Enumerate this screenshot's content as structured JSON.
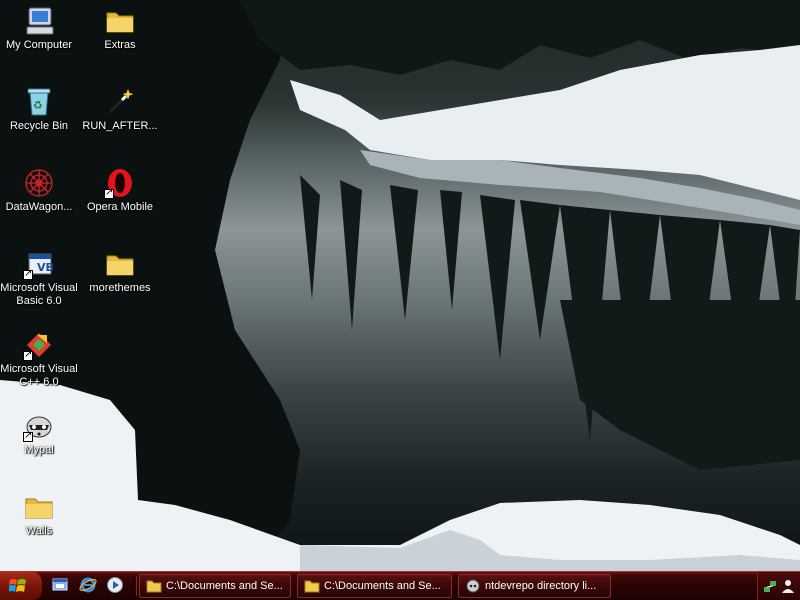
{
  "desktop": {
    "icons": [
      {
        "label": "My Computer",
        "icon": "my-computer-icon"
      },
      {
        "label": "Extras",
        "icon": "folder-icon"
      },
      {
        "label": "Recycle Bin",
        "icon": "recycle-bin-icon"
      },
      {
        "label": "RUN_AFTER...",
        "icon": "magic-wand-icon"
      },
      {
        "label": "DataWagon...",
        "icon": "spider-web-icon"
      },
      {
        "label": "Opera Mobile",
        "icon": "opera-icon"
      },
      {
        "label": "Microsoft Visual Basic 6.0",
        "icon": "visual-basic-icon"
      },
      {
        "label": "morethemes",
        "icon": "folder-icon"
      },
      {
        "label": "Microsoft Visual C++ 6.0",
        "icon": "visual-cpp-icon"
      },
      {
        "label": "Mypal",
        "icon": "raccoon-icon"
      },
      {
        "label": "Walls",
        "icon": "folder-icon"
      }
    ]
  },
  "taskbar": {
    "start_icon": "windows-flag-icon",
    "quick_launch": [
      {
        "icon": "show-desktop-icon"
      },
      {
        "icon": "internet-explorer-icon"
      },
      {
        "icon": "media-player-icon"
      }
    ],
    "tasks": [
      {
        "label": "C:\\Documents and Se...",
        "icon": "folder-icon"
      },
      {
        "label": "C:\\Documents and Se...",
        "icon": "folder-icon"
      },
      {
        "label": "ntdevrepo directory li...",
        "icon": "browser-icon"
      }
    ],
    "tray": [
      {
        "icon": "network-icon"
      },
      {
        "icon": "user-icon"
      }
    ]
  },
  "colors": {
    "taskbar": "#2a0404",
    "label_text": "#ffffff",
    "folder": "#f2c94c"
  }
}
